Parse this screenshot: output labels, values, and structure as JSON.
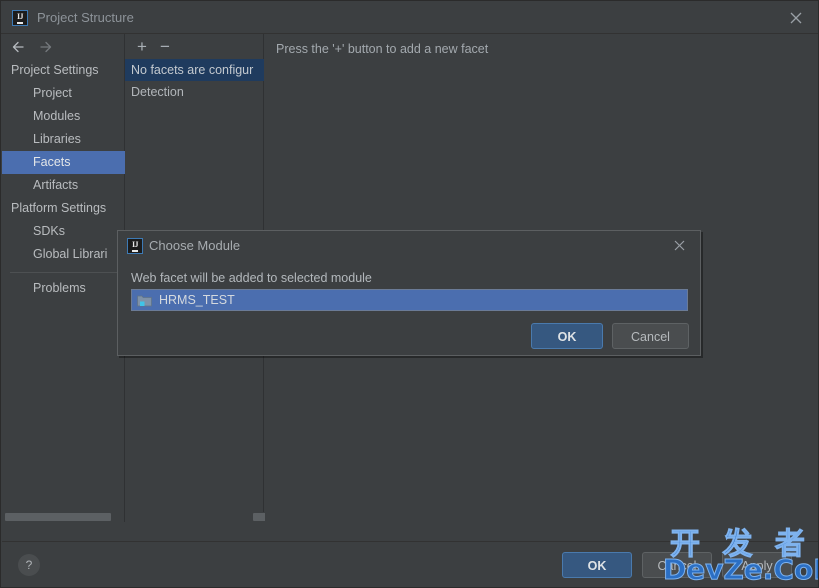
{
  "window": {
    "title": "Project Structure",
    "app_icon": "IJ",
    "close_icon": "close-icon"
  },
  "toolbar": {
    "back_icon": "arrow-left-icon",
    "forward_icon": "arrow-right-icon"
  },
  "sidebar": {
    "items": [
      {
        "label": "Project Settings",
        "type": "group",
        "selected": false
      },
      {
        "label": "Project",
        "type": "child",
        "selected": false
      },
      {
        "label": "Modules",
        "type": "child",
        "selected": false
      },
      {
        "label": "Libraries",
        "type": "child",
        "selected": false
      },
      {
        "label": "Facets",
        "type": "child",
        "selected": true
      },
      {
        "label": "Artifacts",
        "type": "child",
        "selected": false
      },
      {
        "label": "Platform Settings",
        "type": "group",
        "selected": false
      },
      {
        "label": "SDKs",
        "type": "child",
        "selected": false
      },
      {
        "label": "Global Librari",
        "type": "child",
        "selected": false
      }
    ],
    "problems_label": "Problems"
  },
  "facets_panel": {
    "add_label": "+",
    "remove_label": "−",
    "rows": [
      {
        "label": "No facets are configur",
        "selected": true
      },
      {
        "label": "Detection",
        "selected": false
      }
    ]
  },
  "detail": {
    "hint": "Press the '+' button to add a new facet"
  },
  "bottom_bar": {
    "help_label": "?",
    "ok_label": "OK",
    "cancel_label": "Cancel",
    "apply_label": "Apply"
  },
  "dialog": {
    "icon": "IJ",
    "title": "Choose Module",
    "close_icon": "close-icon",
    "message": "Web facet will be added to selected module",
    "module": {
      "icon": "module-folder-icon",
      "name": "HRMS_TEST",
      "selected": true
    },
    "ok_label": "OK",
    "cancel_label": "Cancel"
  },
  "watermark": {
    "chinese": "开 发 者",
    "english": "DevZe.CoM"
  },
  "colors": {
    "window_bg": "#3c3f41",
    "selection_blue": "#4b6eaf",
    "list_selection_dark": "#1f3b5e",
    "primary_button": "#365880",
    "text": "#b9bcbf",
    "watermark_blue": "#2b6fc4"
  }
}
